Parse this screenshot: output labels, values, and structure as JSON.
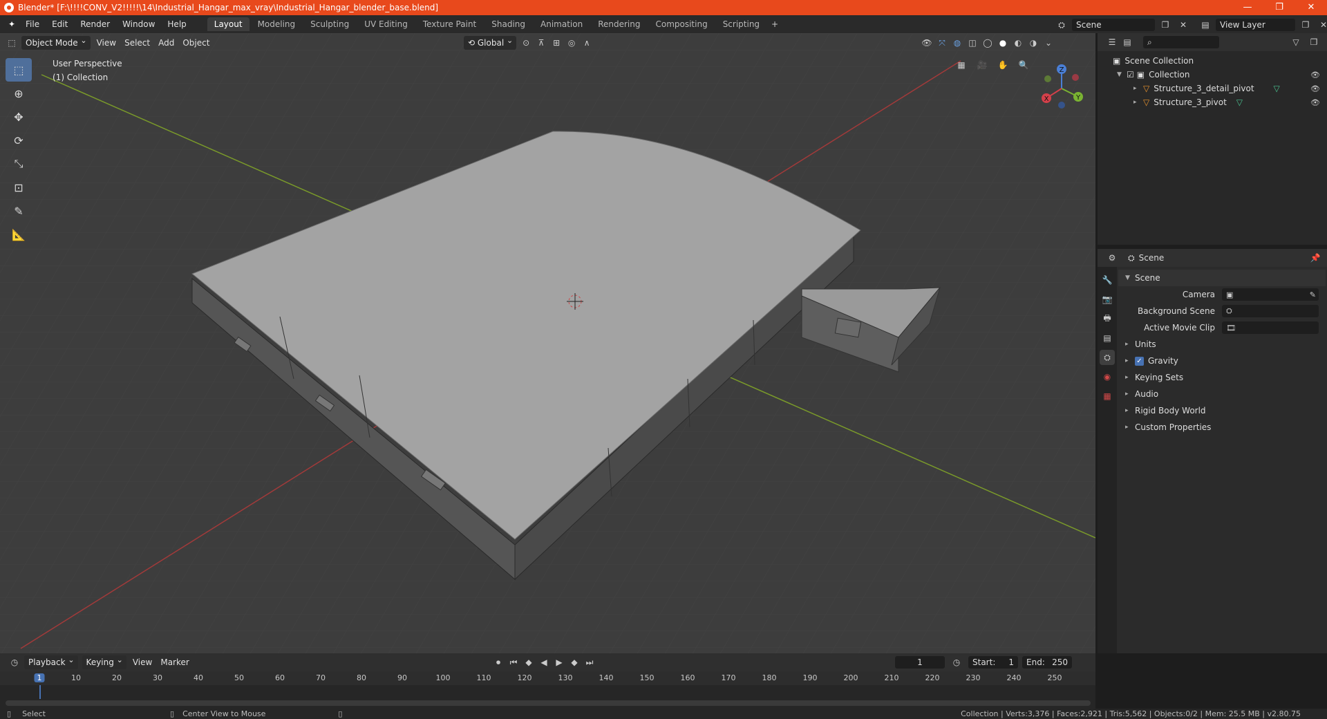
{
  "window": {
    "title": "Blender* [F:\\!!!!CONV_V2!!!!!\\14\\Industrial_Hangar_max_vray\\Industrial_Hangar_blender_base.blend]",
    "controls": [
      "—",
      "❐",
      "✕"
    ]
  },
  "menu": [
    "File",
    "Edit",
    "Render",
    "Window",
    "Help"
  ],
  "workspaces": [
    "Layout",
    "Modeling",
    "Sculpting",
    "UV Editing",
    "Texture Paint",
    "Shading",
    "Animation",
    "Rendering",
    "Compositing",
    "Scripting"
  ],
  "active_workspace": "Layout",
  "scene_field": "Scene",
  "view_layer_field": "View Layer",
  "viewport": {
    "mode": "Object Mode",
    "menus": [
      "View",
      "Select",
      "Add",
      "Object"
    ],
    "transform": "Global",
    "info_line1": "User Perspective",
    "info_line2": "(1) Collection",
    "gizmo": {
      "x": "X",
      "y": "Y",
      "z": "Z"
    }
  },
  "outliner": {
    "search_placeholder": "",
    "root": "Scene Collection",
    "collection": "Collection",
    "items": [
      "Structure_3_detail_pivot",
      "Structure_3_pivot"
    ]
  },
  "properties": {
    "header": "Scene",
    "panel": "Scene",
    "camera_label": "Camera",
    "background_scene_label": "Background Scene",
    "active_movie_clip_label": "Active Movie Clip",
    "subpanels": [
      "Units",
      "Gravity",
      "Keying Sets",
      "Audio",
      "Rigid Body World",
      "Custom Properties"
    ],
    "gravity_checked": true
  },
  "timeline": {
    "menus": [
      "Playback",
      "Keying",
      "View",
      "Marker"
    ],
    "current_frame": "1",
    "start_label": "Start:",
    "start": "1",
    "end_label": "End:",
    "end": "250",
    "ruler": [
      "1",
      "10",
      "20",
      "30",
      "40",
      "50",
      "60",
      "70",
      "80",
      "90",
      "100",
      "110",
      "120",
      "130",
      "140",
      "150",
      "160",
      "170",
      "180",
      "190",
      "200",
      "210",
      "220",
      "230",
      "240",
      "250"
    ]
  },
  "status": {
    "left1": "Select",
    "left2": "Center View to Mouse",
    "right": "Collection | Verts:3,376 | Faces:2,921 | Tris:5,562 | Objects:0/2 | Mem: 25.5 MB | v2.80.75"
  }
}
